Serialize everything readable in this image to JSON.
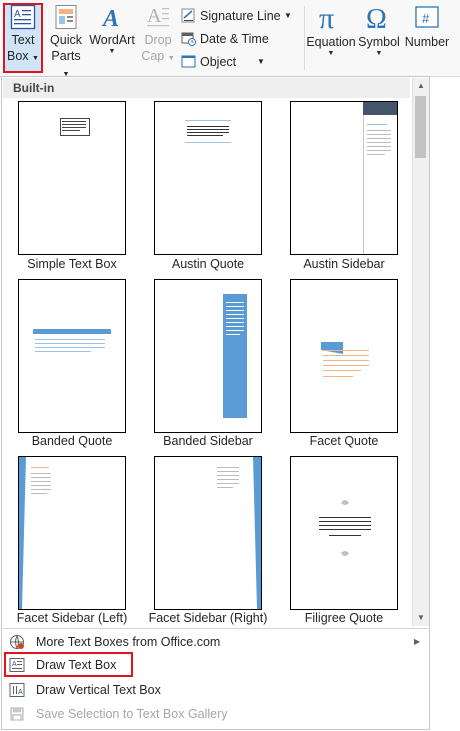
{
  "ribbon": {
    "text_box": {
      "line1": "Text",
      "line2": "Box"
    },
    "quick_parts": {
      "line1": "Quick",
      "line2": "Parts"
    },
    "wordart": {
      "line1": "WordArt"
    },
    "drop_cap": {
      "line1": "Drop",
      "line2": "Cap"
    },
    "signature_line": "Signature Line",
    "date_time": "Date & Time",
    "object": "Object",
    "equation": "Equation",
    "symbol": "Symbol",
    "number": "Number"
  },
  "gallery": {
    "header": "Built-in",
    "items": [
      "Simple Text Box",
      "Austin Quote",
      "Austin Sidebar",
      "Banded Quote",
      "Banded Sidebar",
      "Facet Quote",
      "Facet Sidebar (Left)",
      "Facet Sidebar (Right)",
      "Filigree Quote"
    ]
  },
  "menu": {
    "more": "More Text Boxes from Office.com",
    "draw": "Draw Text Box",
    "draw_vertical": "Draw Vertical Text Box",
    "save_selection": "Save Selection to Text Box Gallery"
  },
  "colors": {
    "accent_blue": "#5b9bd5",
    "selection_red": "#e0141f",
    "navy": "#44546a",
    "orange": "#ed7d31"
  },
  "icons": [
    "text-box-icon",
    "quick-parts-icon",
    "wordart-icon",
    "drop-cap-icon",
    "signature-line-icon",
    "date-time-icon",
    "object-icon",
    "pi-icon",
    "omega-icon",
    "number-icon",
    "office-com-icon",
    "draw-text-box-icon",
    "vertical-text-box-icon",
    "save-selection-icon"
  ]
}
